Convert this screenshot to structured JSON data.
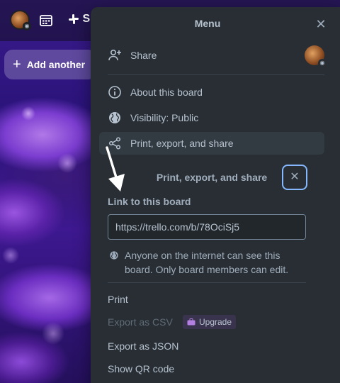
{
  "topbar": {
    "avatar_badge": "◉",
    "slack_label": "S"
  },
  "board": {
    "add_another_label": "Add another"
  },
  "menu": {
    "title": "Menu",
    "close_glyph": "✕",
    "avatar_badge": "◉",
    "items": [
      {
        "label": "Share",
        "icon": "add-user-icon"
      },
      {
        "label": "About this board",
        "icon": "info-icon"
      },
      {
        "label": "Visibility: Public",
        "icon": "globe-icon"
      },
      {
        "label": "Print, export, and share",
        "icon": "share-icon"
      }
    ]
  },
  "popover": {
    "title": "Print, export, and share",
    "close_glyph": "✕",
    "link_label": "Link to this board",
    "link_value": "https://trello.com/b/78OciSj5",
    "info_text": "Anyone on the internet can see this board. Only board members can edit.",
    "print_label": "Print",
    "export_csv_label": "Export as CSV",
    "upgrade_label": "Upgrade",
    "export_json_label": "Export as JSON",
    "qr_label": "Show QR code"
  },
  "colors": {
    "panel_bg": "#282e33",
    "text": "#b6c2cf",
    "focus_ring": "#85b8ff",
    "upgrade_purple": "#9f8fef"
  }
}
